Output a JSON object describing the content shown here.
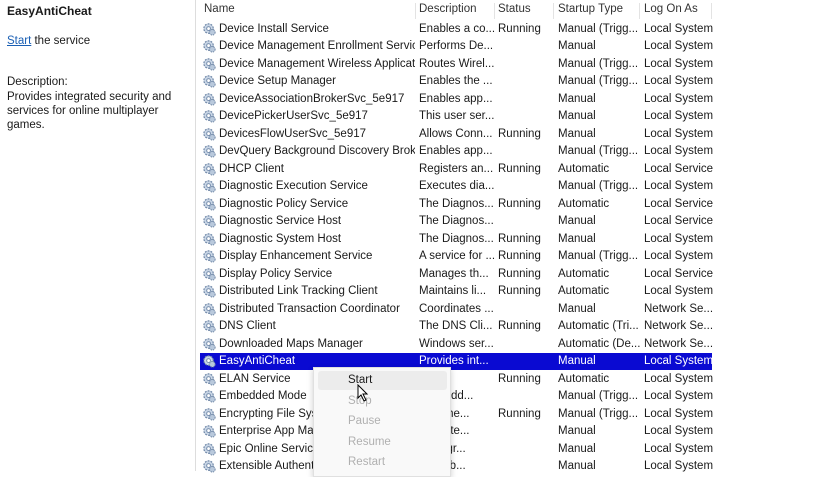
{
  "detail": {
    "title": "EasyAntiCheat",
    "start_link": "Start",
    "start_rest": " the service",
    "desc_label": "Description:",
    "desc_text": "Provides integrated security and services for online multiplayer games."
  },
  "columns": [
    "Name",
    "Description",
    "Status",
    "Startup Type",
    "Log On As"
  ],
  "rows": [
    [
      "Device Install Service",
      "Enables a co...",
      "Running",
      "Manual (Trigg...",
      "Local System"
    ],
    [
      "Device Management Enrollment Service",
      "Performs De...",
      "",
      "Manual",
      "Local System"
    ],
    [
      "Device Management Wireless Applicat...",
      "Routes Wirel...",
      "",
      "Manual (Trigg...",
      "Local System"
    ],
    [
      "Device Setup Manager",
      "Enables the ...",
      "",
      "Manual (Trigg...",
      "Local System"
    ],
    [
      "DeviceAssociationBrokerSvc_5e917",
      "Enables app...",
      "",
      "Manual",
      "Local System"
    ],
    [
      "DevicePickerUserSvc_5e917",
      "This user ser...",
      "",
      "Manual",
      "Local System"
    ],
    [
      "DevicesFlowUserSvc_5e917",
      "Allows Conn...",
      "Running",
      "Manual",
      "Local System"
    ],
    [
      "DevQuery Background Discovery Broker",
      "Enables app...",
      "",
      "Manual (Trigg...",
      "Local System"
    ],
    [
      "DHCP Client",
      "Registers an...",
      "Running",
      "Automatic",
      "Local Service"
    ],
    [
      "Diagnostic Execution Service",
      "Executes dia...",
      "",
      "Manual (Trigg...",
      "Local System"
    ],
    [
      "Diagnostic Policy Service",
      "The Diagnos...",
      "Running",
      "Automatic",
      "Local Service"
    ],
    [
      "Diagnostic Service Host",
      "The Diagnos...",
      "",
      "Manual",
      "Local Service"
    ],
    [
      "Diagnostic System Host",
      "The Diagnos...",
      "Running",
      "Manual",
      "Local System"
    ],
    [
      "Display Enhancement Service",
      "A service for ...",
      "Running",
      "Manual (Trigg...",
      "Local System"
    ],
    [
      "Display Policy Service",
      "Manages th...",
      "Running",
      "Automatic",
      "Local Service"
    ],
    [
      "Distributed Link Tracking Client",
      "Maintains li...",
      "Running",
      "Automatic",
      "Local System"
    ],
    [
      "Distributed Transaction Coordinator",
      "Coordinates ...",
      "",
      "Manual",
      "Network Se..."
    ],
    [
      "DNS Client",
      "The DNS Cli...",
      "Running",
      "Automatic (Tri...",
      "Network Se..."
    ],
    [
      "Downloaded Maps Manager",
      "Windows ser...",
      "",
      "Automatic (De...",
      "Network Se..."
    ],
    [
      "EasyAntiCheat",
      "Provides int...",
      "",
      "Manual",
      "Local System"
    ],
    [
      "ELAN Service",
      "",
      "Running",
      "Automatic",
      "Local System"
    ],
    [
      "Embedded Mode",
      "...mbedd...",
      "",
      "Manual (Trigg...",
      "Local System"
    ],
    [
      "Encrypting File Syst",
      "...es the...",
      "Running",
      "Manual (Trigg...",
      "Local System"
    ],
    [
      "Enterprise App Man",
      "...s ente...",
      "",
      "Manual",
      "Local System"
    ],
    [
      "Epic Online Services",
      "...ackgr...",
      "",
      "Manual",
      "Local System"
    ],
    [
      "Extensible Authenti",
      "...ensib...",
      "",
      "Manual",
      "Local System"
    ]
  ],
  "selected_index": 19,
  "context_menu": [
    {
      "label": "Start",
      "enabled": true
    },
    {
      "label": "Stop",
      "enabled": false
    },
    {
      "label": "Pause",
      "enabled": false
    },
    {
      "label": "Resume",
      "enabled": false
    },
    {
      "label": "Restart",
      "enabled": false
    }
  ]
}
